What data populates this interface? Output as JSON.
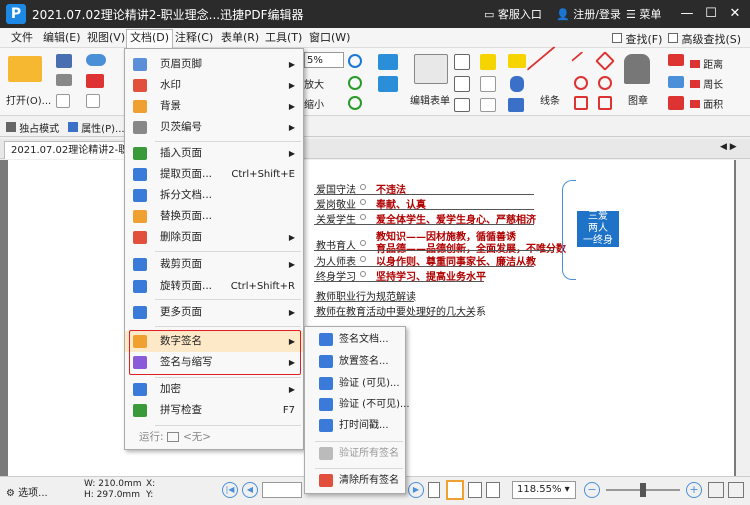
{
  "window": {
    "title": "2021.07.02理论精讲2-职业理念...迅捷PDF编辑器",
    "service": "客服入口",
    "login": "注册/登录",
    "menu": "菜单"
  },
  "menubar": {
    "items": [
      "文件",
      "编辑(E)",
      "视图(V)",
      "文档(D)",
      "注释(C)",
      "表单(R)",
      "工具(T)",
      "窗口(W)"
    ],
    "find": "查找(F)",
    "advanced_find": "高级查找(S)"
  },
  "ribbon": {
    "open": "打开(O)...",
    "zoom_value": "5%",
    "zoom_in": "放大",
    "zoom_out": "缩小",
    "edit_form": "编辑表单",
    "line": "线条",
    "stamp": "图章",
    "distance": "距离",
    "perimeter": "周长",
    "area": "面积"
  },
  "toolbar2": {
    "exclusive_mode": "独占模式",
    "properties": "属性(P)..."
  },
  "doctab": {
    "label": "2021.07.02理论精讲2-职业理"
  },
  "mindmap": {
    "left": [
      "爱国守法",
      "爱岗敬业",
      "关爱学生",
      "教书育人",
      "为人师表",
      "终身学习",
      "教师职业行为规范解读",
      "教师在教育活动中要处理好的几大关系"
    ],
    "right": [
      "不违法",
      "奉献、认真",
      "爱全体学生、爱学生身心、严慈相济",
      "教知识——因材施教，循循善诱",
      "育品德——品德创新，全面发展，不唯分数",
      "以身作则、尊重同事家长、廉洁从教",
      "坚持学习、提高业务水平"
    ],
    "center": [
      "三爱",
      "两人",
      "一终身"
    ]
  },
  "menu": {
    "items": [
      {
        "label": "页眉页脚",
        "shortcut": "",
        "arrow": "▶",
        "icon_color": "#5b8fd8"
      },
      {
        "label": "水印",
        "shortcut": "",
        "arrow": "▶",
        "icon_color": "#e0503c"
      },
      {
        "label": "背景",
        "shortcut": "",
        "arrow": "▶",
        "icon_color": "#f0a030"
      },
      {
        "label": "贝茨编号",
        "shortcut": "",
        "arrow": "▶",
        "icon_color": "#888888"
      },
      {
        "label": "插入页面",
        "shortcut": "",
        "arrow": "▶",
        "icon_color": "#3a9a3a"
      },
      {
        "label": "提取页面...",
        "shortcut": "Ctrl+Shift+E",
        "arrow": "",
        "icon_color": "#3a7ad8"
      },
      {
        "label": "拆分文档...",
        "shortcut": "",
        "arrow": "",
        "icon_color": "#3a7ad8"
      },
      {
        "label": "替换页面...",
        "shortcut": "",
        "arrow": "",
        "icon_color": "#f0a030"
      },
      {
        "label": "删除页面",
        "shortcut": "",
        "arrow": "▶",
        "icon_color": "#e0503c"
      },
      {
        "label": "裁剪页面",
        "shortcut": "",
        "arrow": "▶",
        "icon_color": "#3a7ad8"
      },
      {
        "label": "旋转页面...",
        "shortcut": "Ctrl+Shift+R",
        "arrow": "",
        "icon_color": "#3a7ad8"
      },
      {
        "label": "更多页面",
        "shortcut": "",
        "arrow": "▶",
        "icon_color": "#3a7ad8"
      },
      {
        "label": "数字签名",
        "shortcut": "",
        "arrow": "▶",
        "icon_color": "#f0a030"
      },
      {
        "label": "签名与缩写",
        "shortcut": "",
        "arrow": "▶",
        "icon_color": "#8a5ad8"
      },
      {
        "label": "加密",
        "shortcut": "",
        "arrow": "▶",
        "icon_color": "#3a7ad8"
      },
      {
        "label": "拼写检查",
        "shortcut": "F7",
        "arrow": "",
        "icon_color": "#3a9a3a"
      }
    ],
    "run_label": "运行:",
    "run_value": "<无>"
  },
  "submenu": {
    "items": [
      {
        "label": "签名文档...",
        "disabled": false
      },
      {
        "label": "放置签名...",
        "disabled": false
      },
      {
        "label": "验证 (可见)...",
        "disabled": false
      },
      {
        "label": "验证 (不可见)...",
        "disabled": false
      },
      {
        "label": "打时间戳...",
        "disabled": false
      },
      {
        "label": "验证所有签名",
        "disabled": true
      },
      {
        "label": "清除所有签名",
        "disabled": false
      }
    ]
  },
  "statusbar": {
    "select": "选项...",
    "width": "W: 210.0mm",
    "height": "H: 297.0mm",
    "x": "X:",
    "y": "Y:",
    "zoom": "118.55%"
  }
}
